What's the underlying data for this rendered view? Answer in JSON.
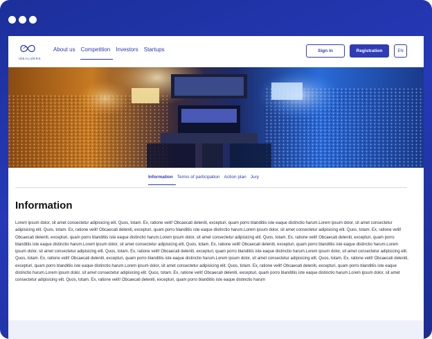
{
  "window": {
    "dots": [
      "red",
      "yellow",
      "green"
    ]
  },
  "brand": {
    "name": "IDEALIZERS",
    "logo_icon": "infinity-icon"
  },
  "nav": [
    {
      "label": "About us",
      "active": false
    },
    {
      "label": "Competition",
      "active": true
    },
    {
      "label": "Investors",
      "active": false
    },
    {
      "label": "Startups",
      "active": false
    }
  ],
  "auth": {
    "signin": "Sign in",
    "register": "Registration",
    "lang": "EN"
  },
  "hero": {
    "image": "esports-arena-photo",
    "colors": {
      "left": "#f0a030",
      "right": "#2a7cf0"
    }
  },
  "tabs": [
    {
      "label": "Information",
      "active": true
    },
    {
      "label": "Terms of participation",
      "active": false
    },
    {
      "label": "Action plan",
      "active": false
    },
    {
      "label": "Jury",
      "active": false
    }
  ],
  "content": {
    "title": "Information",
    "body": "Lorem ipsum dolor, sit amet consectetur adipisicing elit. Quos, totam. Ex, ratione velit! Obcaecati deleniti, excepturi, quam porro blanditiis iste eaque distinctio harum.Lorem ipsum dolor, sit amet consectetur adipisicing elit. Quos, totam. Ex, ratione velit! Obcaecati deleniti, excepturi, quam porro blanditiis iste eaque distinctio harum.Lorem ipsum dolor, sit amet consectetur adipisicing elit. Quos, totam. Ex, ratione velit! Obcaecati deleniti, excepturi, quam porro blanditiis iste eaque distinctio harum.Lorem ipsum dolor, sit amet consectetur adipisicing elit. Quos, totam. Ex, ratione velit! Obcaecati deleniti, excepturi, quam porro blanditiis iste eaque distinctio harum.Lorem ipsum dolor, sit amet consectetur adipisicing elit. Quos, totam. Ex, ratione velit! Obcaecati deleniti, excepturi, quam porro blanditiis iste eaque distinctio harum.Lorem ipsum dolor, sit amet consectetur adipisicing elit. Quos, totam. Ex, ratione velit! Obcaecati deleniti, excepturi, quam porro blanditiis iste eaque distinctio harum.Lorem ipsum dolor, sit amet consectetur adipisicing elit. Quos, totam. Ex, ratione velit! Obcaecati deleniti, excepturi, quam porro blanditiis iste eaque distinctio harum.Lorem ipsum dolor, sit amet consectetur adipisicing elit. Quos, totam. Ex, ratione velit! Obcaecati deleniti, excepturi, quam porro blanditiis iste eaque distinctio harum.Lorem ipsum dolor, sit amet consectetur adipisicing elit. Quos, totam. Ex, ratione velit! Obcaecati deleniti, excepturi, quam porro blanditiis iste eaque distinctio harum.Lorem ipsum dolor, sit amet consectetur adipisicing elit. Quos, totam. Ex, ratione velit! Obcaecati deleniti, excepturi, quam porro blanditiis iste eaque distinctio harum.Lorem ipsum dolor, sit amet consectetur adipisicing elit. Quos, totam. Ex, ratione velit! Obcaecati deleniti, excepturi, quam porro blanditiis iste eaque distinctio harum"
  },
  "colors": {
    "accent": "#2f3cb4",
    "frame": "#2639b8",
    "footer": "#eef0fa"
  }
}
